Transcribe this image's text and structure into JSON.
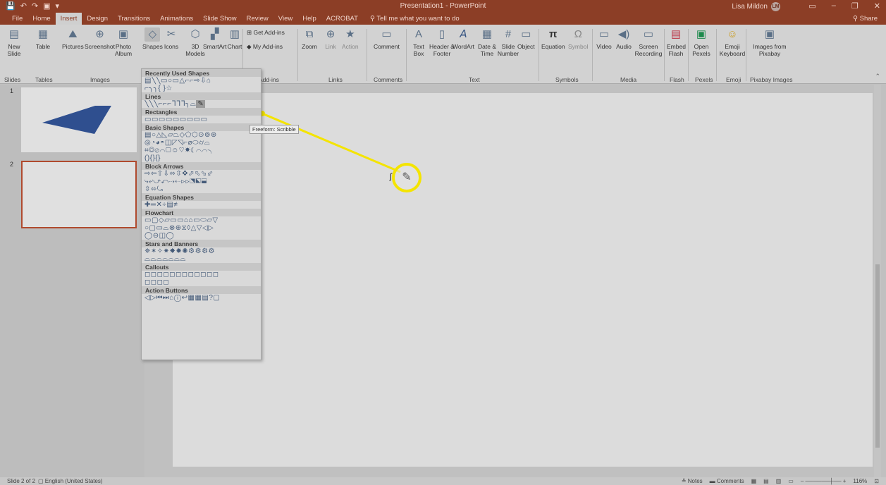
{
  "window": {
    "title": "Presentation1 - PowerPoint",
    "user_name": "Lisa Mildon",
    "user_initials": "LM"
  },
  "tabs": [
    "File",
    "Home",
    "Insert",
    "Design",
    "Transitions",
    "Animations",
    "Slide Show",
    "Review",
    "View",
    "Help",
    "ACROBAT"
  ],
  "active_tab": "Insert",
  "tell_me": "Tell me what you want to do",
  "share": "Share",
  "ribbon": {
    "new_slide": "New Slide",
    "table": "Table",
    "pictures": "Pictures",
    "screenshot": "Screenshot",
    "photo_album": "Photo Album",
    "shapes": "Shapes",
    "icons": "Icons",
    "models_3d": "3D Models",
    "smartart": "SmartArt",
    "chart": "Chart",
    "get_addins": "Get Add-ins",
    "my_addins": "My Add-ins",
    "zoom": "Zoom",
    "link": "Link",
    "action": "Action",
    "comment": "Comment",
    "text_box": "Text Box",
    "header_footer": "Header & Footer",
    "wordart": "WordArt",
    "date_time": "Date & Time",
    "slide_number": "Slide Number",
    "object": "Object",
    "equation": "Equation",
    "symbol": "Symbol",
    "video": "Video",
    "audio": "Audio",
    "screen_recording": "Screen Recording",
    "embed_flash": "Embed Flash",
    "open_pexels": "Open Pexels",
    "emoji_keyboard": "Emoji Keyboard",
    "images_from_pixabay": "Images from Pixabay",
    "groups": {
      "slides": "Slides",
      "tables": "Tables",
      "images": "Images",
      "addins": "Add-ins",
      "links": "Links",
      "comments": "Comments",
      "text": "Text",
      "symbols": "Symbols",
      "media": "Media",
      "flash": "Flash",
      "pexels": "Pexels",
      "emoji": "Emoji",
      "pixabay": "Pixabay Images"
    }
  },
  "shapes_menu": {
    "sections": [
      {
        "title": "Recently Used Shapes",
        "rows": [
          "▤╲╲▭○▭△⌐⌐⇨⇩⌂",
          "⌐╮╮{ }☆"
        ]
      },
      {
        "title": "Lines",
        "rows": [
          "╲╲╲⌐⌐⌐ᒣᒣᒣ╮⌓"
        ]
      },
      {
        "title": "Rectangles",
        "rows": [
          "▭▭▭▭▭▭▭▭▭"
        ]
      },
      {
        "title": "Basic Shapes",
        "rows": [
          "▤○△◺▱⏢◇⬠⬡⊙⊚⊛",
          "◎◔◕◓◫◸◹⌐⌀⬭⌭⌓",
          "⌗◎⊘⌒▢☺♡☀☾⌒⌒╮",
          "(){}{}"
        ]
      },
      {
        "title": "Block Arrows",
        "rows": [
          "⇨⇦⇧⇩⬄⇳✥⬀⬁⬂⬃",
          "⤷⤶⤻⤺⇢⇠⊳⊳⬔⬕⬓",
          "⇳⬄⤿"
        ]
      },
      {
        "title": "Equation Shapes",
        "rows": [
          "✚═✕÷▤≠"
        ]
      },
      {
        "title": "Flowchart",
        "rows": [
          "▭▢◇▱▭▭⌂⌂▭⬭▱▽",
          "○▢▭⌓⊗⊕⧖◊△▽◁▷",
          "◯⊖◫◯"
        ]
      },
      {
        "title": "Stars and Banners",
        "rows": [
          "✵✶✧✷✸✹✺⚙⚙⚙⚙",
          "⌓⌓⌓⌓⌓⌓⌓"
        ]
      },
      {
        "title": "Callouts",
        "rows": [
          "◻◻◻◻◻◻◻◻◻◻◻◻",
          "◻◻◻◻"
        ]
      },
      {
        "title": "Action Buttons",
        "rows": [
          "◁▷⏮⏭⌂ⓘ↩▦▦▤?▢"
        ]
      }
    ],
    "tooltip": "Freeform: Scribble"
  },
  "slides": [
    {
      "number": "1"
    },
    {
      "number": "2"
    }
  ],
  "status": {
    "slide_of": "Slide 2 of 2",
    "language": "English (United States)",
    "notes": "Notes",
    "comments": "Comments",
    "zoom": "116%"
  },
  "colors": {
    "titlebar": "#8c3e26",
    "highlight": "#f4e400",
    "slide_shape": "#2f4f8f"
  }
}
